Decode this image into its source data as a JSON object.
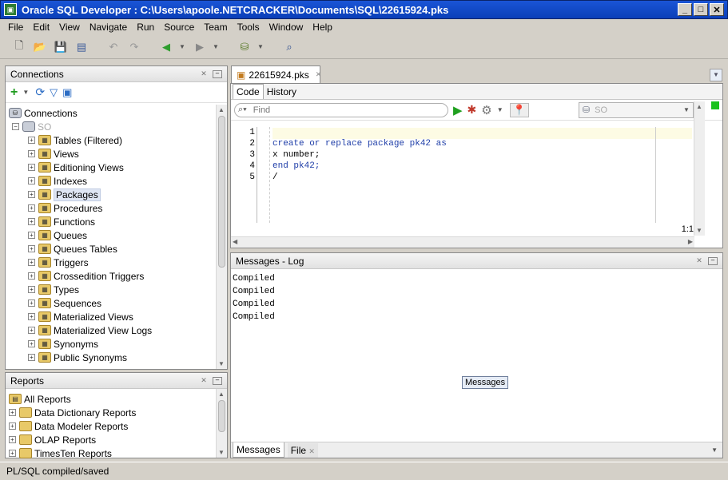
{
  "window": {
    "title": "Oracle SQL Developer : C:\\Users\\apoole.NETCRACKER\\Documents\\SQL\\22615924.pks"
  },
  "menu": [
    "File",
    "Edit",
    "View",
    "Navigate",
    "Run",
    "Source",
    "Team",
    "Tools",
    "Window",
    "Help"
  ],
  "connections": {
    "panel_title": "Connections",
    "root": "Connections",
    "connection": "SO",
    "items": [
      "Tables (Filtered)",
      "Views",
      "Editioning Views",
      "Indexes",
      "Packages",
      "Procedures",
      "Functions",
      "Queues",
      "Queues Tables",
      "Triggers",
      "Crossedition Triggers",
      "Types",
      "Sequences",
      "Materialized Views",
      "Materialized View Logs",
      "Synonyms",
      "Public Synonyms"
    ],
    "selected": "Packages"
  },
  "reports": {
    "panel_title": "Reports",
    "root": "All Reports",
    "items": [
      "Data Dictionary Reports",
      "Data Modeler Reports",
      "OLAP Reports",
      "TimesTen Reports"
    ]
  },
  "editor": {
    "tab_label": "22615924.pks",
    "subtabs": [
      "Code",
      "History"
    ],
    "active_subtab": "Code",
    "find_placeholder": "Find",
    "connection_select": "SO",
    "line_numbers": [
      "1",
      "2",
      "3",
      "4",
      "5"
    ],
    "lines": [
      "",
      "create or replace package pk42 as",
      "x number;",
      "end pk42;",
      "/"
    ],
    "cursor_pos": "1:1"
  },
  "messages": {
    "panel_title": "Messages - Log",
    "lines": [
      "Compiled",
      "Compiled",
      "Compiled",
      "Compiled"
    ],
    "tooltip": "Messages",
    "bottom_tabs": [
      "Messages",
      "File"
    ]
  },
  "status": {
    "text": "PL/SQL compiled/saved"
  }
}
